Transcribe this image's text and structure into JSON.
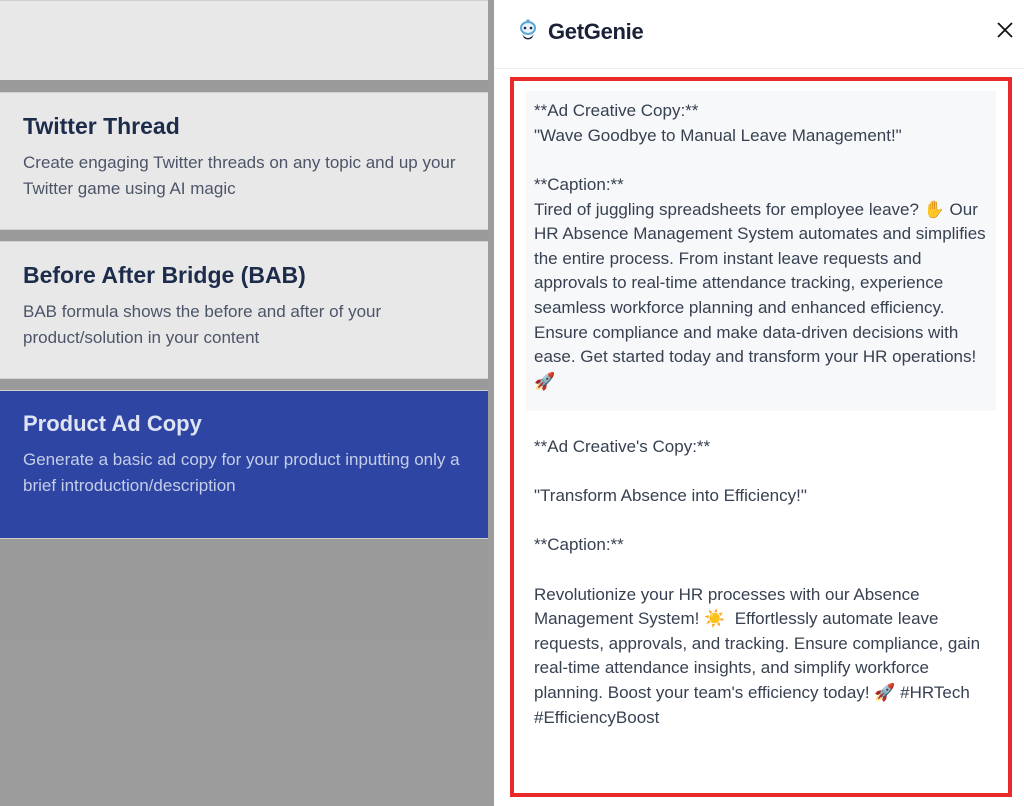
{
  "brand": {
    "name": "GetGenie"
  },
  "templates": [
    {
      "title": "Twitter Thread",
      "description": "Create engaging Twitter threads on any topic and up your Twitter game using AI magic"
    },
    {
      "title": "Before After Bridge (BAB)",
      "description": "BAB formula shows the before and after of your product/solution in your content"
    },
    {
      "title": "Product Ad Copy",
      "description": "Generate a basic ad copy for your product inputting only a brief introduction/description"
    }
  ],
  "outputs": [
    {
      "text": "**Ad Creative Copy:**\n\"Wave Goodbye to Manual Leave Management!\"\n\n**Caption:**\nTired of juggling spreadsheets for employee leave? ✋ Our HR Absence Management System automates and simplifies the entire process. From instant leave requests and approvals to real-time attendance tracking, experience seamless workforce planning and enhanced efficiency. Ensure compliance and make data-driven decisions with ease. Get started today and transform your HR operations! 🚀"
    },
    {
      "text": "**Ad Creative's Copy:**\n\n\"Transform Absence into Efficiency!\"\n\n**Caption:**\n\nRevolutionize your HR processes with our Absence Management System! ☀️  Effortlessly automate leave requests, approvals, and tracking. Ensure compliance, gain real-time attendance insights, and simplify workforce planning. Boost your team's efficiency today! 🚀 #HRTech #EfficiencyBoost"
    }
  ]
}
